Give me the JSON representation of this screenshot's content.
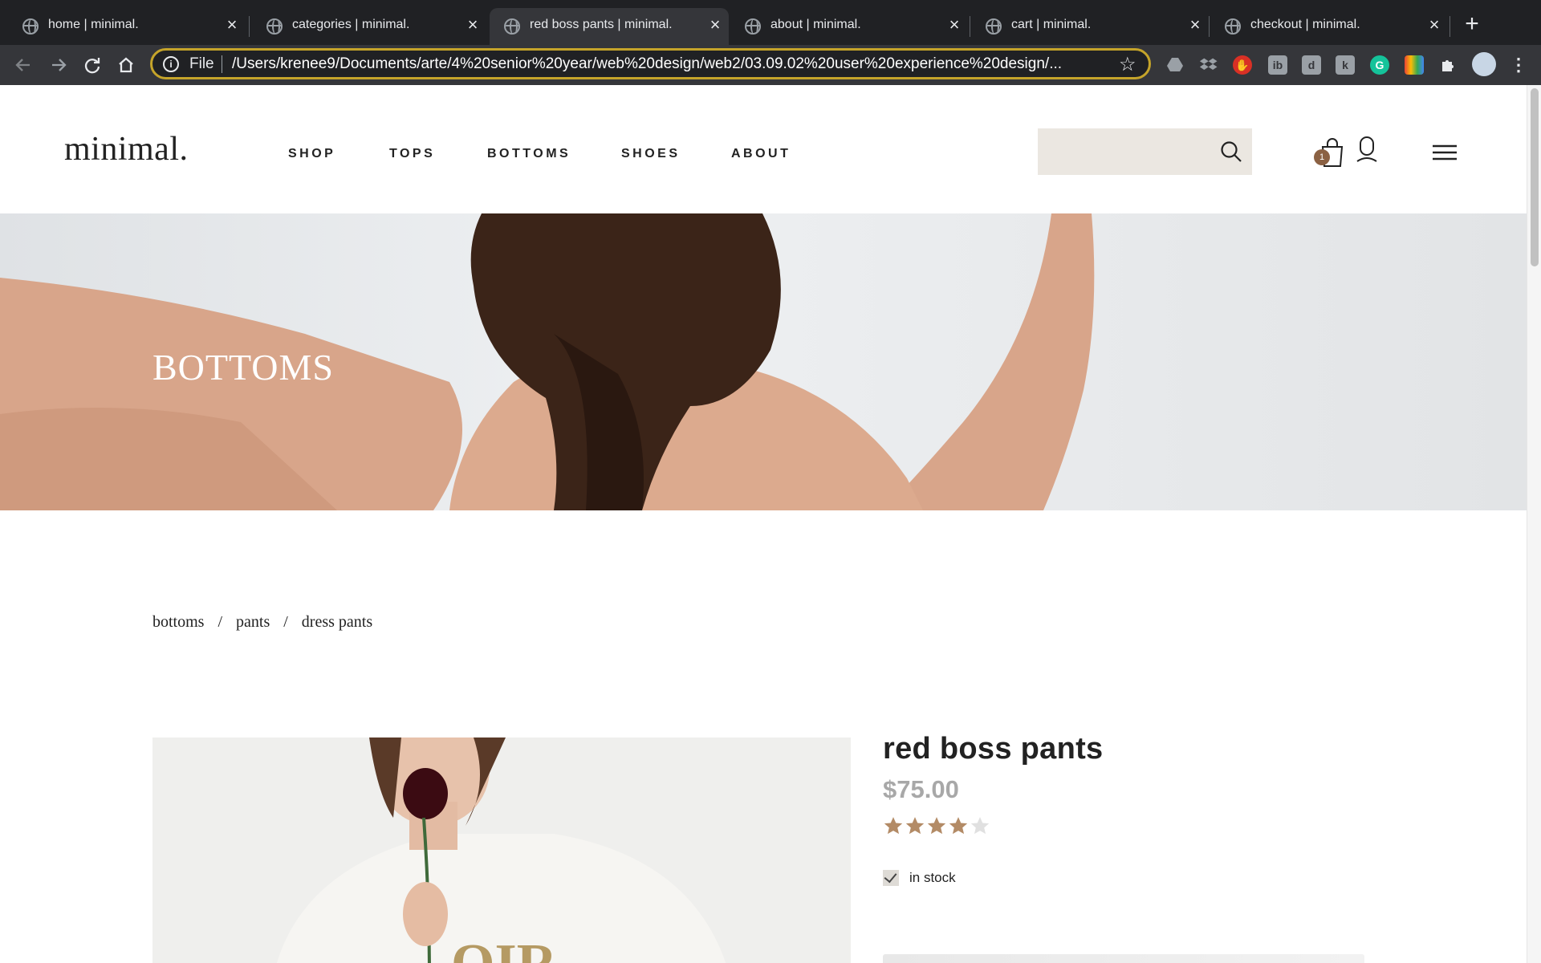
{
  "browser": {
    "tabs": [
      {
        "title": "home | minimal."
      },
      {
        "title": "categories | minimal."
      },
      {
        "title": "red boss pants | minimal."
      },
      {
        "title": "about | minimal."
      },
      {
        "title": "cart | minimal."
      },
      {
        "title": "checkout | minimal."
      }
    ],
    "active_tab": 2,
    "address": {
      "scheme": "File",
      "url": "/Users/krenee9/Documents/arte/4%20senior%20year/web%20design/web2/03.09.02%20user%20experience%20design/..."
    },
    "accent_color": "#c5a42a"
  },
  "site": {
    "logo": "minimal.",
    "nav": [
      "SHOP",
      "TOPS",
      "BOTTOMS",
      "SHOES",
      "ABOUT"
    ],
    "search": {
      "placeholder": "",
      "value": ""
    },
    "cart_count": "1",
    "colors": {
      "search_bg": "#ebe7e1",
      "badge": "#8b6143",
      "star_filled": "#b38b66",
      "star_empty": "#e0e0e0"
    }
  },
  "hero": {
    "title": "BOTTOMS"
  },
  "breadcrumb": [
    "bottoms",
    "/",
    "pants",
    "/",
    "dress pants"
  ],
  "product": {
    "name": "red boss pants",
    "price": "$75.00",
    "rating": 4,
    "rating_max": 5,
    "stock_label": "in stock",
    "in_stock_checked": true
  }
}
